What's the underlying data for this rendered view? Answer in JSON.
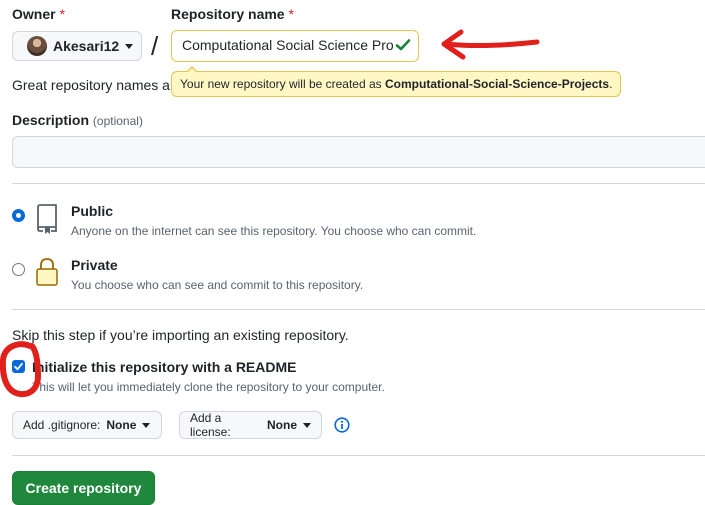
{
  "owner": {
    "label": "Owner",
    "required_mark": "*",
    "value": "Akesari12"
  },
  "repository": {
    "label": "Repository name",
    "required_mark": "*",
    "separator": "/",
    "value": "Computational Social Science Pro",
    "tooltip_prefix": "Your new repository will be created as",
    "tooltip_name": "Computational-Social-Science-Projects",
    "tooltip_suffix": "."
  },
  "hint_text": "Great repository names ar",
  "description": {
    "label": "Description",
    "optional": "(optional)",
    "value": ""
  },
  "visibility": {
    "public": {
      "title": "Public",
      "subtitle": "Anyone on the internet can see this repository. You choose who can commit.",
      "selected": true
    },
    "private": {
      "title": "Private",
      "subtitle": "You choose who can see and commit to this repository.",
      "selected": false
    }
  },
  "initialize": {
    "skip_text": "Skip this step if you’re importing an existing repository.",
    "readme_title": "Initialize this repository with a README",
    "readme_subtitle": "This will let you immediately clone the repository to your computer.",
    "readme_checked": true
  },
  "gitignore": {
    "label": "Add .gitignore:",
    "value": "None"
  },
  "license": {
    "label": "Add a license:",
    "value": "None"
  },
  "create_button": "Create repository",
  "colors": {
    "primary": "#1f883d",
    "accent": "#0969da",
    "annotation": "#e0201b",
    "tooltip_bg": "#fff8c5"
  },
  "icons": [
    "chevron-down-icon",
    "check-icon",
    "repo-icon",
    "lock-icon",
    "info-icon"
  ]
}
